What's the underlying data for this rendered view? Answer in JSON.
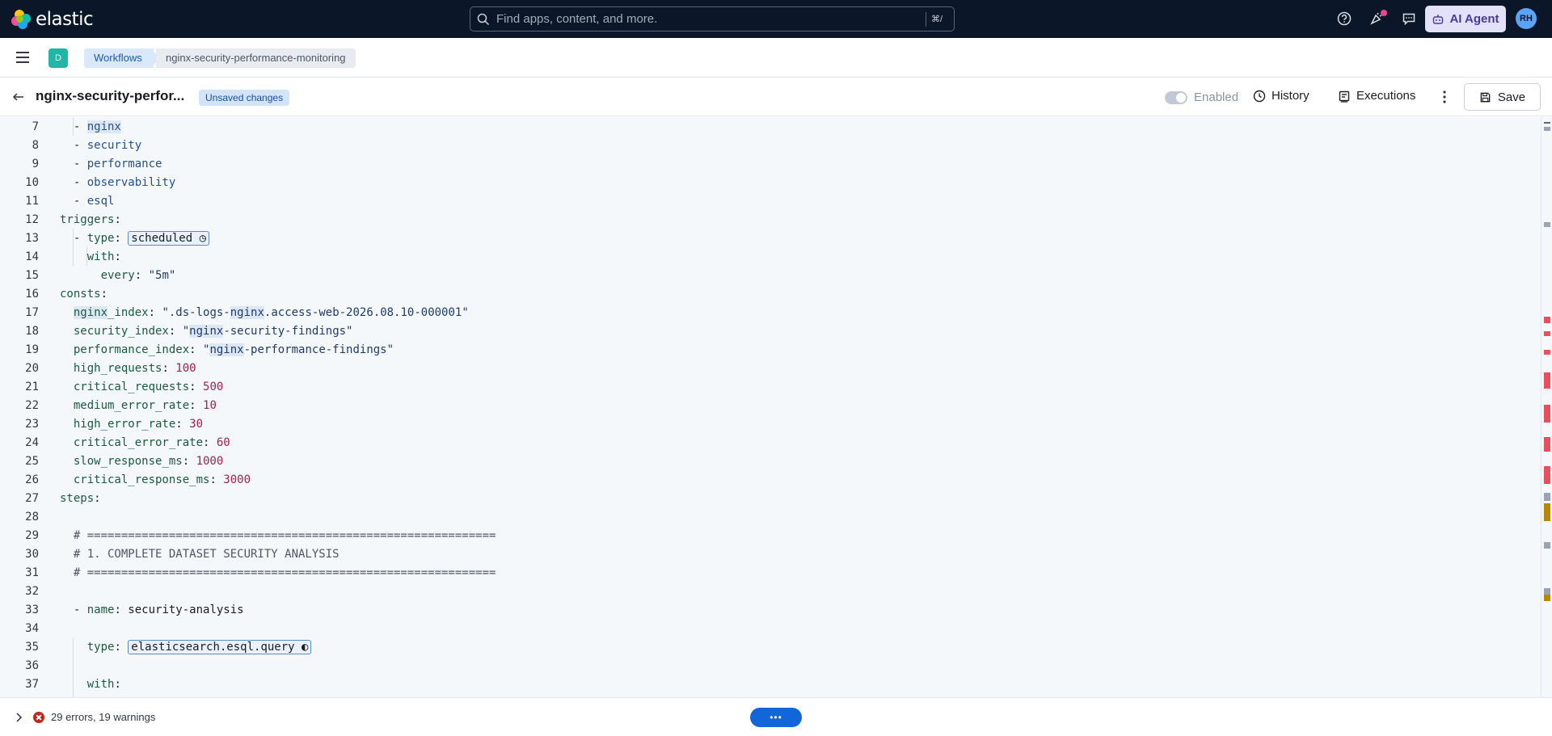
{
  "header": {
    "logo_text": "elastic",
    "search_placeholder": "Find apps, content, and more.",
    "search_shortcut": "⌘/",
    "ai_agent_label": "AI Agent",
    "avatar_initials": "RH"
  },
  "breadcrumbs": {
    "space_initial": "D",
    "items": [
      "Workflows",
      "nginx-security-performance-monitoring"
    ]
  },
  "toolbar": {
    "title": "nginx-security-perfor...",
    "unsaved_badge": "Unsaved changes",
    "enabled_label": "Enabled",
    "history_label": "History",
    "executions_label": "Executions",
    "save_label": "Save"
  },
  "editor": {
    "lines": [
      {
        "n": "7",
        "t": "  - nginx"
      },
      {
        "n": "8",
        "t": "  - security"
      },
      {
        "n": "9",
        "t": "  - performance"
      },
      {
        "n": "10",
        "t": "  - observability"
      },
      {
        "n": "11",
        "t": "  - esql"
      },
      {
        "n": "12",
        "t": "triggers:"
      },
      {
        "n": "13",
        "t": "  - type: scheduled"
      },
      {
        "n": "14",
        "t": "    with:"
      },
      {
        "n": "15",
        "t": "      every: \"5m\""
      },
      {
        "n": "16",
        "t": "consts:"
      },
      {
        "n": "17",
        "t": "  nginx_index: \".ds-logs-nginx.access-web-2026.08.10-000001\""
      },
      {
        "n": "18",
        "t": "  security_index: \"nginx-security-findings\""
      },
      {
        "n": "19",
        "t": "  performance_index: \"nginx-performance-findings\""
      },
      {
        "n": "20",
        "t": "  high_requests: 100"
      },
      {
        "n": "21",
        "t": "  critical_requests: 500"
      },
      {
        "n": "22",
        "t": "  medium_error_rate: 10"
      },
      {
        "n": "23",
        "t": "  high_error_rate: 30"
      },
      {
        "n": "24",
        "t": "  critical_error_rate: 60"
      },
      {
        "n": "25",
        "t": "  slow_response_ms: 1000"
      },
      {
        "n": "26",
        "t": "  critical_response_ms: 3000"
      },
      {
        "n": "27",
        "t": "steps:"
      },
      {
        "n": "28",
        "t": ""
      },
      {
        "n": "29",
        "t": "  # ============================================================"
      },
      {
        "n": "30",
        "t": "  # 1. COMPLETE DATASET SECURITY ANALYSIS"
      },
      {
        "n": "31",
        "t": "  # ============================================================"
      },
      {
        "n": "32",
        "t": ""
      },
      {
        "n": "33",
        "t": "  - name: security-analysis"
      },
      {
        "n": "34",
        "t": ""
      },
      {
        "n": "35",
        "t": "    type: elasticsearch.esql.query"
      },
      {
        "n": "36",
        "t": ""
      },
      {
        "n": "37",
        "t": "    with:"
      }
    ]
  },
  "footer": {
    "status_text": "29 errors, 19 warnings",
    "handle_text": "•••"
  },
  "colors": {
    "header_bg": "#0b1628",
    "accent": "#1266d8",
    "error": "#bd271e",
    "warning": "#b58900",
    "editor_bg": "#f5f8fb"
  }
}
